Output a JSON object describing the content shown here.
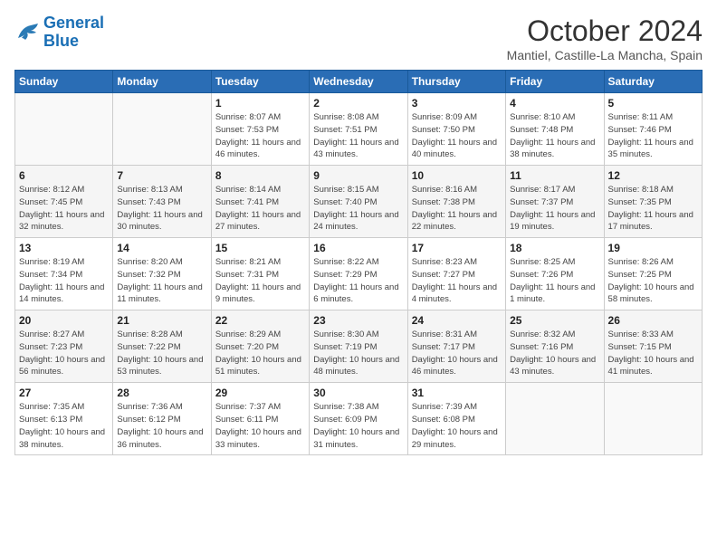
{
  "logo": {
    "line1": "General",
    "line2": "Blue"
  },
  "title": "October 2024",
  "location": "Mantiel, Castille-La Mancha, Spain",
  "days_of_week": [
    "Sunday",
    "Monday",
    "Tuesday",
    "Wednesday",
    "Thursday",
    "Friday",
    "Saturday"
  ],
  "weeks": [
    [
      {
        "day": null
      },
      {
        "day": null
      },
      {
        "day": 1,
        "sunrise": "Sunrise: 8:07 AM",
        "sunset": "Sunset: 7:53 PM",
        "daylight": "Daylight: 11 hours and 46 minutes."
      },
      {
        "day": 2,
        "sunrise": "Sunrise: 8:08 AM",
        "sunset": "Sunset: 7:51 PM",
        "daylight": "Daylight: 11 hours and 43 minutes."
      },
      {
        "day": 3,
        "sunrise": "Sunrise: 8:09 AM",
        "sunset": "Sunset: 7:50 PM",
        "daylight": "Daylight: 11 hours and 40 minutes."
      },
      {
        "day": 4,
        "sunrise": "Sunrise: 8:10 AM",
        "sunset": "Sunset: 7:48 PM",
        "daylight": "Daylight: 11 hours and 38 minutes."
      },
      {
        "day": 5,
        "sunrise": "Sunrise: 8:11 AM",
        "sunset": "Sunset: 7:46 PM",
        "daylight": "Daylight: 11 hours and 35 minutes."
      }
    ],
    [
      {
        "day": 6,
        "sunrise": "Sunrise: 8:12 AM",
        "sunset": "Sunset: 7:45 PM",
        "daylight": "Daylight: 11 hours and 32 minutes."
      },
      {
        "day": 7,
        "sunrise": "Sunrise: 8:13 AM",
        "sunset": "Sunset: 7:43 PM",
        "daylight": "Daylight: 11 hours and 30 minutes."
      },
      {
        "day": 8,
        "sunrise": "Sunrise: 8:14 AM",
        "sunset": "Sunset: 7:41 PM",
        "daylight": "Daylight: 11 hours and 27 minutes."
      },
      {
        "day": 9,
        "sunrise": "Sunrise: 8:15 AM",
        "sunset": "Sunset: 7:40 PM",
        "daylight": "Daylight: 11 hours and 24 minutes."
      },
      {
        "day": 10,
        "sunrise": "Sunrise: 8:16 AM",
        "sunset": "Sunset: 7:38 PM",
        "daylight": "Daylight: 11 hours and 22 minutes."
      },
      {
        "day": 11,
        "sunrise": "Sunrise: 8:17 AM",
        "sunset": "Sunset: 7:37 PM",
        "daylight": "Daylight: 11 hours and 19 minutes."
      },
      {
        "day": 12,
        "sunrise": "Sunrise: 8:18 AM",
        "sunset": "Sunset: 7:35 PM",
        "daylight": "Daylight: 11 hours and 17 minutes."
      }
    ],
    [
      {
        "day": 13,
        "sunrise": "Sunrise: 8:19 AM",
        "sunset": "Sunset: 7:34 PM",
        "daylight": "Daylight: 11 hours and 14 minutes."
      },
      {
        "day": 14,
        "sunrise": "Sunrise: 8:20 AM",
        "sunset": "Sunset: 7:32 PM",
        "daylight": "Daylight: 11 hours and 11 minutes."
      },
      {
        "day": 15,
        "sunrise": "Sunrise: 8:21 AM",
        "sunset": "Sunset: 7:31 PM",
        "daylight": "Daylight: 11 hours and 9 minutes."
      },
      {
        "day": 16,
        "sunrise": "Sunrise: 8:22 AM",
        "sunset": "Sunset: 7:29 PM",
        "daylight": "Daylight: 11 hours and 6 minutes."
      },
      {
        "day": 17,
        "sunrise": "Sunrise: 8:23 AM",
        "sunset": "Sunset: 7:27 PM",
        "daylight": "Daylight: 11 hours and 4 minutes."
      },
      {
        "day": 18,
        "sunrise": "Sunrise: 8:25 AM",
        "sunset": "Sunset: 7:26 PM",
        "daylight": "Daylight: 11 hours and 1 minute."
      },
      {
        "day": 19,
        "sunrise": "Sunrise: 8:26 AM",
        "sunset": "Sunset: 7:25 PM",
        "daylight": "Daylight: 10 hours and 58 minutes."
      }
    ],
    [
      {
        "day": 20,
        "sunrise": "Sunrise: 8:27 AM",
        "sunset": "Sunset: 7:23 PM",
        "daylight": "Daylight: 10 hours and 56 minutes."
      },
      {
        "day": 21,
        "sunrise": "Sunrise: 8:28 AM",
        "sunset": "Sunset: 7:22 PM",
        "daylight": "Daylight: 10 hours and 53 minutes."
      },
      {
        "day": 22,
        "sunrise": "Sunrise: 8:29 AM",
        "sunset": "Sunset: 7:20 PM",
        "daylight": "Daylight: 10 hours and 51 minutes."
      },
      {
        "day": 23,
        "sunrise": "Sunrise: 8:30 AM",
        "sunset": "Sunset: 7:19 PM",
        "daylight": "Daylight: 10 hours and 48 minutes."
      },
      {
        "day": 24,
        "sunrise": "Sunrise: 8:31 AM",
        "sunset": "Sunset: 7:17 PM",
        "daylight": "Daylight: 10 hours and 46 minutes."
      },
      {
        "day": 25,
        "sunrise": "Sunrise: 8:32 AM",
        "sunset": "Sunset: 7:16 PM",
        "daylight": "Daylight: 10 hours and 43 minutes."
      },
      {
        "day": 26,
        "sunrise": "Sunrise: 8:33 AM",
        "sunset": "Sunset: 7:15 PM",
        "daylight": "Daylight: 10 hours and 41 minutes."
      }
    ],
    [
      {
        "day": 27,
        "sunrise": "Sunrise: 7:35 AM",
        "sunset": "Sunset: 6:13 PM",
        "daylight": "Daylight: 10 hours and 38 minutes."
      },
      {
        "day": 28,
        "sunrise": "Sunrise: 7:36 AM",
        "sunset": "Sunset: 6:12 PM",
        "daylight": "Daylight: 10 hours and 36 minutes."
      },
      {
        "day": 29,
        "sunrise": "Sunrise: 7:37 AM",
        "sunset": "Sunset: 6:11 PM",
        "daylight": "Daylight: 10 hours and 33 minutes."
      },
      {
        "day": 30,
        "sunrise": "Sunrise: 7:38 AM",
        "sunset": "Sunset: 6:09 PM",
        "daylight": "Daylight: 10 hours and 31 minutes."
      },
      {
        "day": 31,
        "sunrise": "Sunrise: 7:39 AM",
        "sunset": "Sunset: 6:08 PM",
        "daylight": "Daylight: 10 hours and 29 minutes."
      },
      {
        "day": null
      },
      {
        "day": null
      }
    ]
  ]
}
